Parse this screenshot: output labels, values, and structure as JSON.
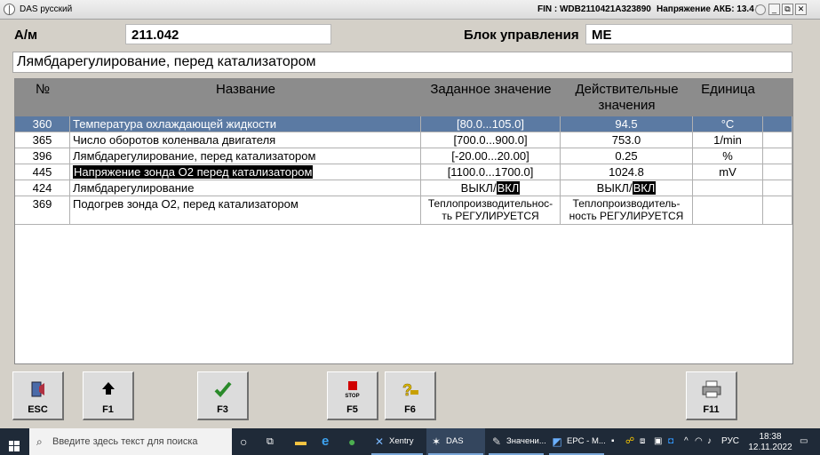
{
  "titlebar": {
    "app_title": "DAS русский",
    "fin": "FIN : WDB2110421A323890",
    "battery": "Напряжение АКБ: 13.4 V",
    "btn_min": "_",
    "btn_max": "⧉",
    "btn_close": "✕"
  },
  "header": {
    "am_label": "А/м",
    "am_value": "211.042",
    "ecu_label": "Блок управления",
    "ecu_value": "ME",
    "function_title": "Лямбдарегулирование, перед катализатором"
  },
  "table": {
    "columns": [
      "№",
      "Название",
      "Заданное значение",
      "Действительные",
      "значения",
      "Единица"
    ],
    "rows": [
      {
        "num": "360",
        "name": "Температура охлаждающей жидкости",
        "spec": "[80.0...105.0]",
        "actual": "94.5",
        "unit": "°C"
      },
      {
        "num": "365",
        "name": "Число оборотов коленвала двигателя",
        "spec": "[700.0...900.0]",
        "actual": "753.0",
        "unit": "1/min"
      },
      {
        "num": "396",
        "name": "Лямбдарегулирование, перед катализатором",
        "spec": "[-20.00...20.00]",
        "actual": "0.25",
        "unit": "%"
      },
      {
        "num": "445",
        "name": "Напряжение зонда O2 перед катализатором",
        "spec": "[1100.0...1700.0]",
        "actual": "1024.8",
        "unit": "mV"
      },
      {
        "num": "424",
        "name": "Лямбдарегулирование",
        "spec_off": "ВЫКЛ/",
        "spec_on": "ВКЛ",
        "actual_off": "ВЫКЛ/",
        "actual_on": "ВКЛ",
        "unit": ""
      },
      {
        "num": "369",
        "name": "Подогрев зонда O2, перед катализатором",
        "spec_l1": "Теплопроизводительнос-",
        "spec_l2": "ть РЕГУЛИРУЕТСЯ",
        "actual_l1": "Теплопроизводитель-",
        "actual_l2": "ность РЕГУЛИРУЕТСЯ",
        "unit": ""
      }
    ]
  },
  "fkeys": [
    {
      "caption": "ESC",
      "icon": "exit-door-icon"
    },
    {
      "caption": "F1",
      "icon": "arrow-up-icon"
    },
    {
      "caption": "F3",
      "icon": "checkmark-icon"
    },
    {
      "caption": "F5",
      "icon": "stop-icon",
      "icon_text": "STOP"
    },
    {
      "caption": "F6",
      "icon": "help-key-icon"
    },
    {
      "caption": "F11",
      "icon": "printer-icon"
    }
  ],
  "taskbar": {
    "search_placeholder": "Введите здесь текст для поиска",
    "apps": [
      "Xentry",
      "DAS рус...",
      "Значени...",
      "EPC - M..."
    ],
    "lang": "РУС",
    "time": "18:38",
    "date": "12.11.2022"
  },
  "colors": {
    "selected_row": "#5b7aa3",
    "header_bg": "#8c8c8c",
    "window_bg": "#d4d0c8"
  }
}
